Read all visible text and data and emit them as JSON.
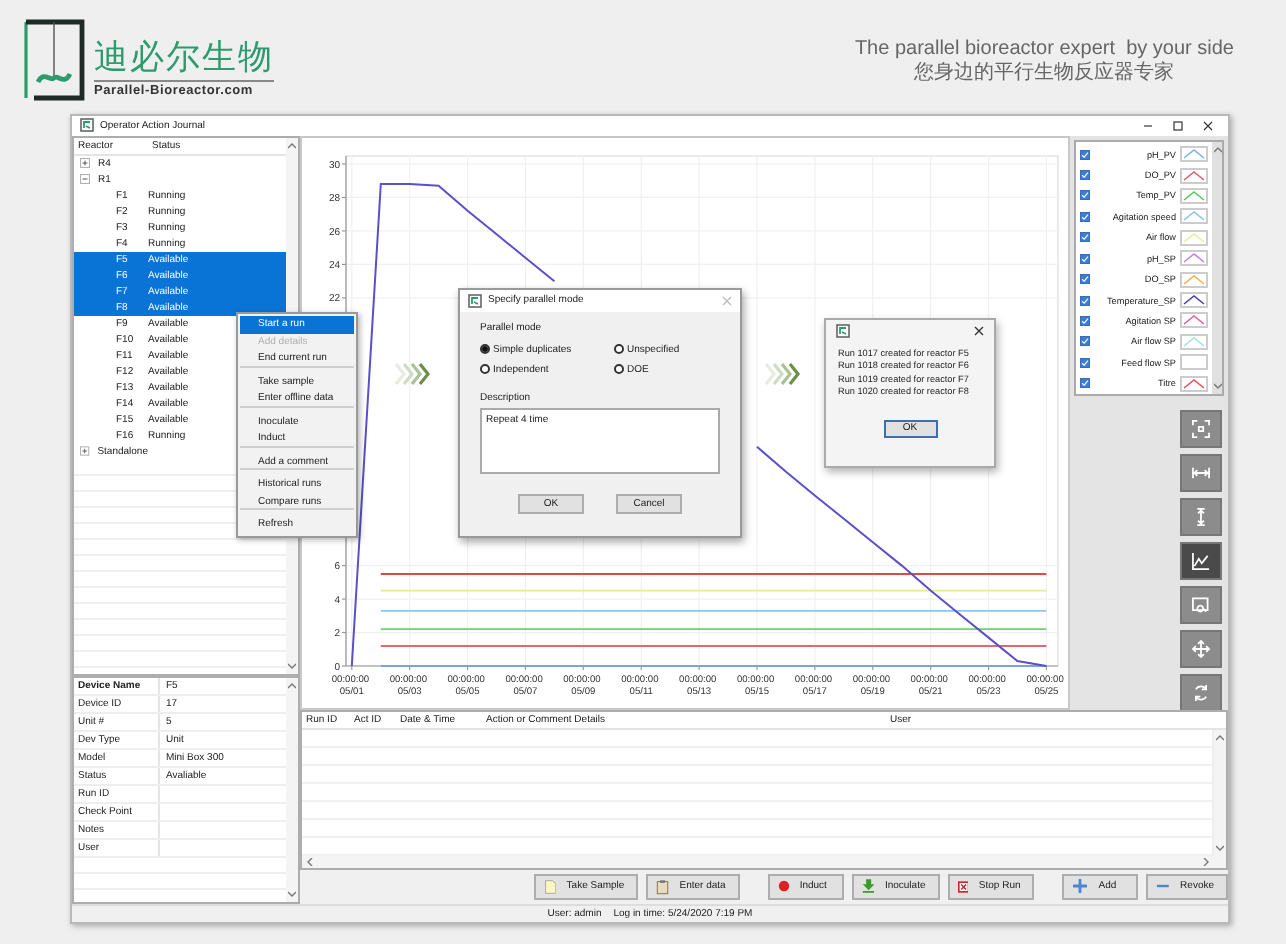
{
  "header": {
    "brand": "迪必尔生物",
    "site": "Parallel-Bioreactor.com",
    "tagline": "The parallel bioreactor expert  by your side",
    "tagline_zh": "您身边的平行生物反应器专家"
  },
  "window": {
    "title": "Operator Action Journal"
  },
  "tree": {
    "columns": [
      "Reactor",
      "Status"
    ],
    "items": [
      {
        "name": "R4",
        "expanded": false
      },
      {
        "name": "R1",
        "expanded": true,
        "children": [
          {
            "name": "F1",
            "status": "Running",
            "selected": false
          },
          {
            "name": "F2",
            "status": "Running",
            "selected": false
          },
          {
            "name": "F3",
            "status": "Running",
            "selected": false
          },
          {
            "name": "F4",
            "status": "Running",
            "selected": false
          },
          {
            "name": "F5",
            "status": "Available",
            "selected": true
          },
          {
            "name": "F6",
            "status": "Available",
            "selected": true
          },
          {
            "name": "F7",
            "status": "Available",
            "selected": true
          },
          {
            "name": "F8",
            "status": "Available",
            "selected": true
          },
          {
            "name": "F9",
            "status": "Available",
            "selected": false
          },
          {
            "name": "F10",
            "status": "Available",
            "selected": false
          },
          {
            "name": "F11",
            "status": "Available",
            "selected": false
          },
          {
            "name": "F12",
            "status": "Available",
            "selected": false
          },
          {
            "name": "F13",
            "status": "Available",
            "selected": false
          },
          {
            "name": "F14",
            "status": "Available",
            "selected": false
          },
          {
            "name": "F15",
            "status": "Available",
            "selected": false
          },
          {
            "name": "F16",
            "status": "Running",
            "selected": false
          }
        ]
      },
      {
        "name": "Standalone",
        "expanded": false
      }
    ]
  },
  "context_menu": [
    {
      "label": "Start a run",
      "highlighted": true,
      "disabled": false,
      "separator_after": false
    },
    {
      "label": "Add details",
      "highlighted": false,
      "disabled": true,
      "separator_after": false
    },
    {
      "label": "End current run",
      "highlighted": false,
      "disabled": false,
      "separator_after": true
    },
    {
      "label": "Take sample",
      "highlighted": false,
      "disabled": false,
      "separator_after": false
    },
    {
      "label": "Enter offline data",
      "highlighted": false,
      "disabled": false,
      "separator_after": true
    },
    {
      "label": "Inoculate",
      "highlighted": false,
      "disabled": false,
      "separator_after": false
    },
    {
      "label": "Induct",
      "highlighted": false,
      "disabled": false,
      "separator_after": true
    },
    {
      "label": "Add a comment",
      "highlighted": false,
      "disabled": false,
      "separator_after": true
    },
    {
      "label": "Historical runs",
      "highlighted": false,
      "disabled": false,
      "separator_after": false
    },
    {
      "label": "Compare runs",
      "highlighted": false,
      "disabled": false,
      "separator_after": true
    },
    {
      "label": "Refresh",
      "highlighted": false,
      "disabled": false,
      "separator_after": false
    }
  ],
  "details": [
    {
      "key": "Device Name",
      "value": "F5"
    },
    {
      "key": "Device ID",
      "value": "17"
    },
    {
      "key": "Unit #",
      "value": "5"
    },
    {
      "key": "Dev Type",
      "value": "Unit"
    },
    {
      "key": "Model",
      "value": "Mini Box 300"
    },
    {
      "key": "Status",
      "value": "Avaliable"
    },
    {
      "key": "Run ID"
    },
    {
      "key": "Check Point"
    },
    {
      "key": "Notes"
    },
    {
      "key": "User"
    }
  ],
  "chart": {
    "chart_data": {
      "type": "line",
      "grid": true,
      "ylim": [
        0,
        30
      ],
      "categories": [
        "00:00:00 05/01",
        null,
        "00:00:00 05/03",
        null,
        "00:00:00 05/05",
        null,
        "00:00:00 05/07",
        null,
        "00:00:00 05/09",
        null,
        "00:00:00 05/11",
        null,
        "00:00:00 05/13",
        null,
        "00:00:00 05/15",
        null,
        "00:00:00 05/17",
        null,
        "00:00:00 05/19",
        null,
        "00:00:00 05/21",
        null,
        "00:00:00 05/23",
        null,
        "00:00:00 05/25"
      ],
      "yticks": [
        0,
        2,
        4,
        6,
        22,
        24,
        26,
        28,
        30
      ],
      "series": [
        {
          "color": "#5a50c8",
          "values": [
            0,
            28.8,
            28.8,
            28.7,
            27.2,
            25.8,
            24.4,
            23.0,
            null,
            null,
            null,
            null,
            null,
            null,
            13.1,
            11.6,
            10.2,
            8.8,
            7.4,
            6.0,
            4.5,
            3.1,
            1.7,
            0.3,
            0
          ]
        },
        {
          "color": "#e04848",
          "values": [
            null,
            5.5,
            5.5,
            5.5,
            5.5,
            5.5,
            5.5,
            5.5,
            5.5,
            5.5,
            5.5,
            5.5,
            5.5,
            5.5,
            5.5,
            5.5,
            5.5,
            5.5,
            5.5,
            5.5,
            5.5,
            5.5,
            5.5,
            5.5,
            5.5
          ]
        },
        {
          "color": "#e6ea98",
          "values": [
            null,
            4.5,
            4.5,
            4.5,
            4.5,
            4.5,
            4.5,
            4.5,
            4.5,
            4.5,
            4.5,
            4.5,
            4.5,
            4.5,
            4.5,
            4.5,
            4.5,
            4.5,
            4.5,
            4.5,
            4.5,
            4.5,
            4.5,
            4.5,
            4.5
          ]
        },
        {
          "color": "#8ec6ee",
          "values": [
            null,
            3.3,
            3.3,
            3.3,
            3.3,
            3.3,
            3.3,
            3.3,
            3.3,
            3.3,
            3.3,
            3.3,
            3.3,
            3.3,
            3.3,
            3.3,
            3.3,
            3.3,
            3.3,
            3.3,
            3.3,
            3.3,
            3.3,
            3.3,
            3.3
          ]
        },
        {
          "color": "#6cd46c",
          "values": [
            null,
            2.2,
            2.2,
            2.2,
            2.2,
            2.2,
            2.2,
            2.2,
            2.2,
            2.2,
            2.2,
            2.2,
            2.2,
            2.2,
            2.2,
            2.2,
            2.2,
            2.2,
            2.2,
            2.2,
            2.2,
            2.2,
            2.2,
            2.2,
            2.2
          ]
        },
        {
          "color": "#e06a6a",
          "values": [
            null,
            1.2,
            1.2,
            1.2,
            1.2,
            1.2,
            1.2,
            1.2,
            1.2,
            1.2,
            1.2,
            1.2,
            1.2,
            1.2,
            1.2,
            1.2,
            1.2,
            1.2,
            1.2,
            1.2,
            1.2,
            1.2,
            1.2,
            1.2,
            1.2
          ]
        },
        {
          "color": "#7aa2e6",
          "values": [
            null,
            0,
            0,
            0,
            0,
            0,
            0,
            0,
            0,
            0,
            0,
            0,
            0,
            0,
            0,
            0,
            0,
            0,
            0,
            0,
            0,
            0,
            0,
            0,
            0
          ]
        }
      ]
    }
  },
  "legend": [
    {
      "name": "pH_PV",
      "checked": true,
      "color": "#78b2e4"
    },
    {
      "name": "DO_PV",
      "checked": true,
      "color": "#e05a6e"
    },
    {
      "name": "Temp_PV",
      "checked": true,
      "color": "#5cc45c"
    },
    {
      "name": "Agitation speed",
      "checked": true,
      "color": "#86c4ea"
    },
    {
      "name": "Air flow",
      "checked": true,
      "color": "#e4ee9c"
    },
    {
      "name": "pH_SP",
      "checked": true,
      "color": "#c07ee2"
    },
    {
      "name": "DO_SP",
      "checked": true,
      "color": "#f0b04c"
    },
    {
      "name": "Temperature_SP",
      "checked": true,
      "color": "#4a3eae"
    },
    {
      "name": "Agitation SP",
      "checked": true,
      "color": "#e05ea2"
    },
    {
      "name": "Air flow SP",
      "checked": true,
      "color": "#a2e2e0"
    },
    {
      "name": "Feed flow SP",
      "checked": true,
      "color": "#ffffff"
    },
    {
      "name": "Titre",
      "checked": true,
      "color": "#e0505e"
    }
  ],
  "tools": [
    {
      "kind": "fit",
      "selected": false
    },
    {
      "kind": "width",
      "selected": false
    },
    {
      "kind": "height",
      "selected": false
    },
    {
      "kind": "chart",
      "selected": true
    },
    {
      "kind": "zoom",
      "selected": false
    },
    {
      "kind": "move",
      "selected": false
    },
    {
      "kind": "reset",
      "selected": false
    }
  ],
  "parallel_dialog": {
    "title": "Specify parallel mode",
    "group": "Parallel mode",
    "options": [
      {
        "label": "Simple duplicates",
        "selected": true
      },
      {
        "label": "Unspecified",
        "selected": false
      },
      {
        "label": "Independent",
        "selected": false
      },
      {
        "label": "DOE",
        "selected": false
      }
    ],
    "description_label": "Description",
    "description": "Repeat 4 time",
    "buttons": [
      "OK",
      "Cancel"
    ]
  },
  "message_box": {
    "lines": [
      "Run 1017 created for reactor F5",
      "Run 1018 created for reactor F6",
      "Run 1019 created for reactor F7",
      "Run 1020 created for reactor F8"
    ],
    "button": "OK"
  },
  "log_table": {
    "columns": [
      "Run ID",
      "Act ID",
      "Date & Time",
      "Action or Comment Details",
      "User"
    ]
  },
  "actions": [
    {
      "label": "Take Sample",
      "kind": "sample",
      "separated": false
    },
    {
      "label": "Enter data",
      "kind": "data",
      "separated": false
    },
    {
      "label": "Induct",
      "kind": "induct",
      "separated": true
    },
    {
      "label": "Inoculate",
      "kind": "inoculate",
      "separated": false
    },
    {
      "label": "Stop Run",
      "kind": "stop",
      "separated": false
    },
    {
      "label": "Add",
      "kind": "add",
      "separated": true
    },
    {
      "label": "Revoke",
      "kind": "revoke",
      "separated": false
    }
  ],
  "status_bar": {
    "user": "User: admin",
    "login": "Log in time: 5/24/2020 7:19 PM"
  }
}
